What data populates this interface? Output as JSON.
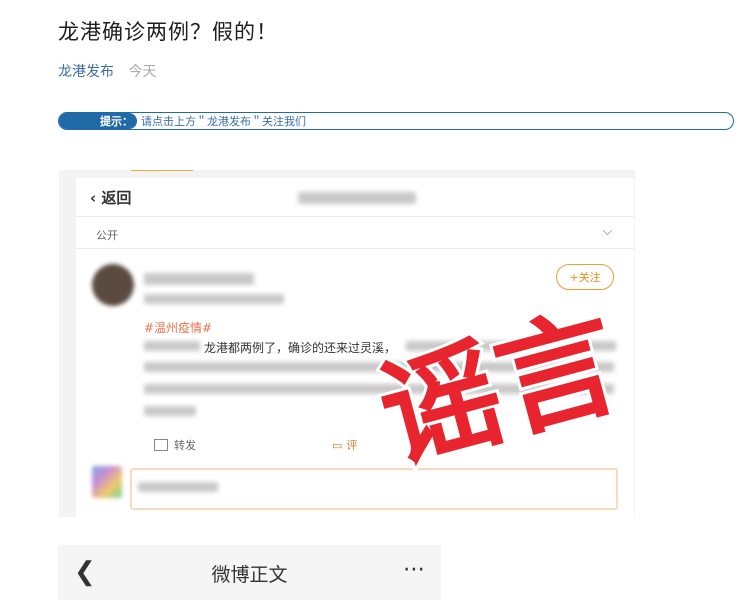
{
  "article": {
    "title": "龙港确诊两例？假的！",
    "author": "龙港发布",
    "date": "今天"
  },
  "tip": {
    "label": "提示：",
    "text": "请点击上方＂龙港发布＂关注我们"
  },
  "screenshot": {
    "back_label": "返回",
    "visibility": "公开",
    "follow_label": "+关注",
    "hashtag": "#温州疫情#",
    "post_text": "龙港都两例了，确诊的还来过灵溪，",
    "repost_label": "转发",
    "comment_label": "评",
    "stamp_text": "谣言",
    "stamp_color": "#e8252e"
  },
  "bottom_nav": {
    "title": "微博正文",
    "back_icon": "chevron-left-icon",
    "more_icon": "more-dots-icon"
  }
}
